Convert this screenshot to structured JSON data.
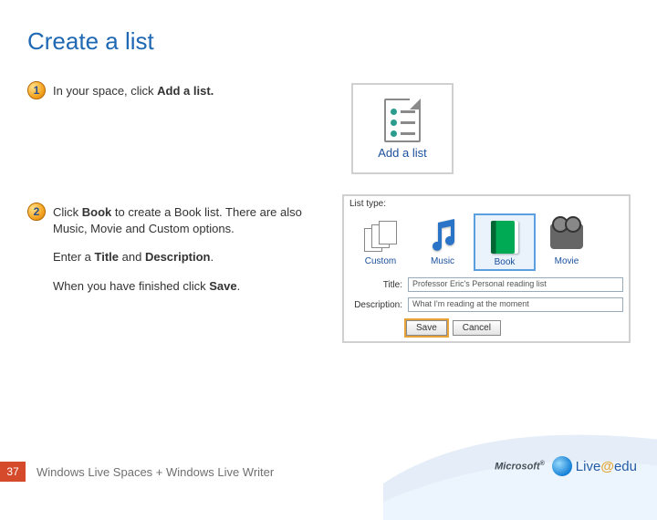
{
  "title": "Create a list",
  "steps": {
    "step1": {
      "num": "1",
      "text_before": "In your space, click ",
      "bold": "Add a list.",
      "text_after": ""
    },
    "step2": {
      "num": "2",
      "p1_before": "Click ",
      "p1_bold1": "Book",
      "p1_mid": " to create a Book list. There are also Music, Movie and Custom options.",
      "p2_before": "Enter a ",
      "p2_bold1": "Title",
      "p2_mid": " and ",
      "p2_bold2": "Description",
      "p2_after": ".",
      "p3_before": "When you have finished click ",
      "p3_bold": "Save",
      "p3_after": "."
    }
  },
  "addlist_card": {
    "label": "Add a list"
  },
  "listtype": {
    "label": "List type:",
    "types": {
      "custom": "Custom",
      "music": "Music",
      "book": "Book",
      "movie": "Movie"
    },
    "title_label": "Title:",
    "title_value": "Professor Eric's Personal reading list",
    "desc_label": "Description:",
    "desc_value": "What I'm reading at the moment",
    "save": "Save",
    "cancel": "Cancel"
  },
  "footer": {
    "page": "37",
    "text": "Windows Live Spaces + Windows Live Writer"
  },
  "brand": {
    "microsoft": "Microsoft",
    "live": "Live",
    "at": "@",
    "edu": "edu"
  }
}
